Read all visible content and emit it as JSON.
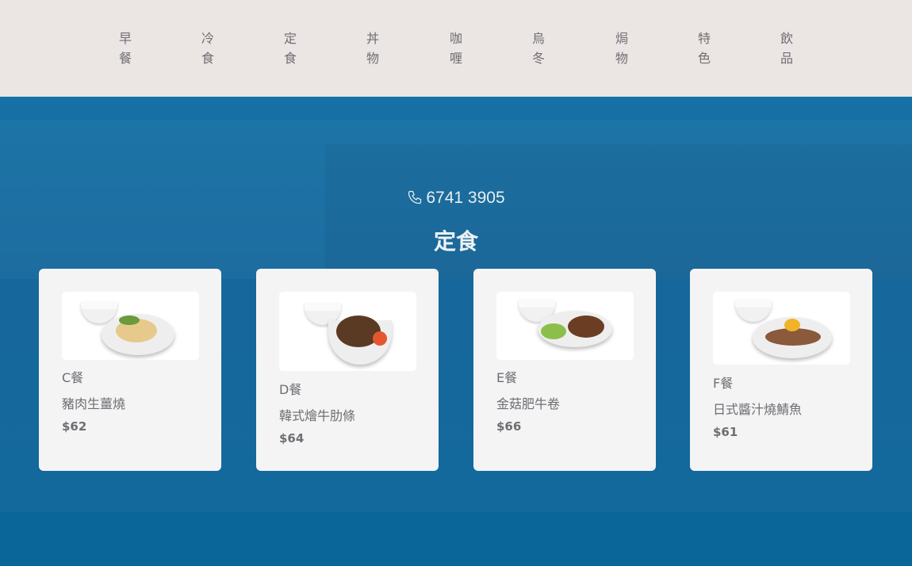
{
  "nav": {
    "items": [
      {
        "line1": "早",
        "line2": "餐"
      },
      {
        "line1": "冷",
        "line2": "食"
      },
      {
        "line1": "定",
        "line2": "食"
      },
      {
        "line1": "丼",
        "line2": "物"
      },
      {
        "line1": "咖",
        "line2": "喱"
      },
      {
        "line1": "烏",
        "line2": "冬"
      },
      {
        "line1": "焗",
        "line2": "物"
      },
      {
        "line1": "特",
        "line2": "色"
      },
      {
        "line1": "飲",
        "line2": "品"
      }
    ]
  },
  "hero": {
    "phone_icon": "phone-icon",
    "phone": "6741 3905",
    "title": "定食"
  },
  "cards": [
    {
      "label": "C餐",
      "name": "豬肉生薑燒",
      "price": "$62"
    },
    {
      "label": "D餐",
      "name": "韓式燴牛肋條",
      "price": "$64"
    },
    {
      "label": "E餐",
      "name": "金菇肥牛卷",
      "price": "$66"
    },
    {
      "label": "F餐",
      "name": "日式醬汁燒鯖魚",
      "price": "$61"
    }
  ],
  "colors": {
    "header_bg": "#ebe5e3",
    "hero_bg": "#1671a6",
    "card_bg": "#f4f4f5",
    "text": "#6e6e73"
  }
}
